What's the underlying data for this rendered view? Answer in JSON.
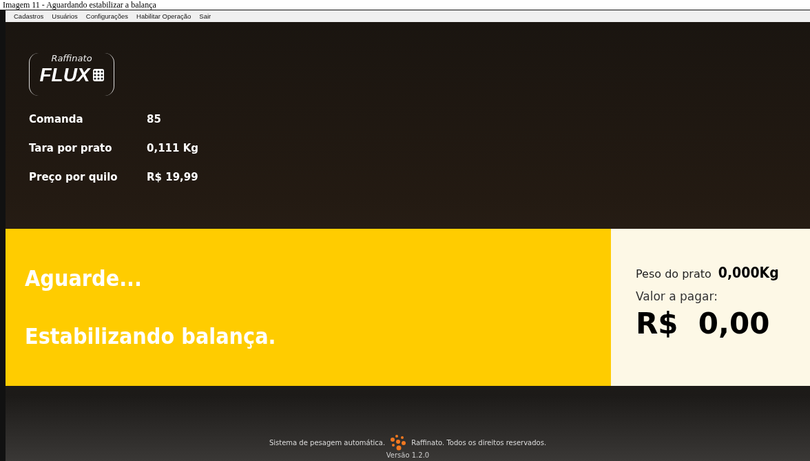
{
  "caption": "Imagem 11 - Aguardando estabilizar a balança",
  "menu": [
    {
      "label": "Cadastros"
    },
    {
      "label": "Usuários"
    },
    {
      "label": "Configurações"
    },
    {
      "label": "Habilitar Operação"
    },
    {
      "label": "Sair"
    }
  ],
  "logo": {
    "top": "Raffinato",
    "main": "FLUX"
  },
  "info": [
    {
      "label": "Comanda",
      "value": "85"
    },
    {
      "label": "Tara por prato",
      "value": "0,111 Kg"
    },
    {
      "label": "Preço por quilo",
      "value": "R$ 19,99"
    }
  ],
  "status": {
    "line_1": "Aguarde...",
    "line_2": "Estabilizando balança."
  },
  "weight": {
    "label": "Peso do prato",
    "value": "0,000Kg"
  },
  "payment": {
    "label": "Valor a pagar:",
    "value": "R$  0,00"
  },
  "footer": {
    "left": "Sistema de pesagem automática.",
    "right": "Raffinato. Todos os direitos reservados.",
    "version": "Versão 1.2.0"
  }
}
